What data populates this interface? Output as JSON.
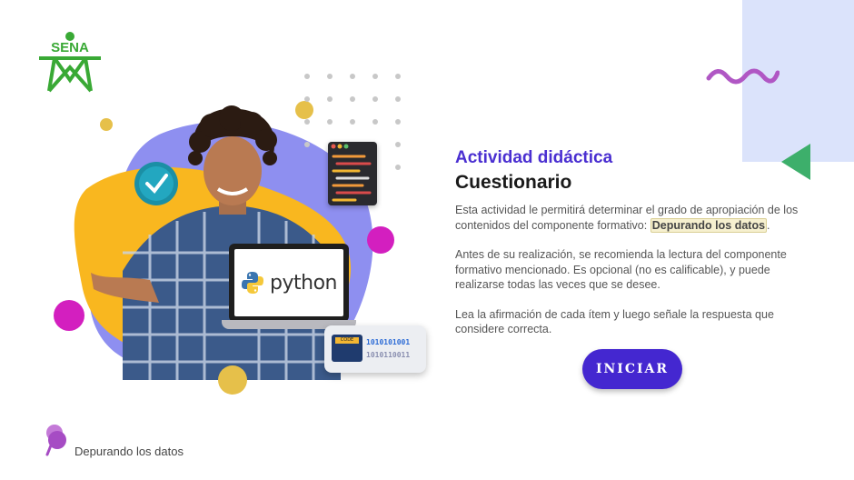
{
  "brand": {
    "logo_text": "SENA",
    "logo_color": "#39a935"
  },
  "content": {
    "activity_label": "Actividad didáctica",
    "activity_title": "Cuestionario",
    "paragraph1_text": "Esta actividad le permitirá determinar el grado de apropiación de los contenidos del componente formativo: ",
    "paragraph1_highlight": "Depurando los datos",
    "paragraph1_end": ".",
    "paragraph2": "Antes de su realización, se recomienda la lectura del componente formativo mencionado.  Es opcional (no es calificable), y puede realizarse todas las veces que se desee.",
    "paragraph3": "Lea la afirmación de cada ítem y luego señale la respuesta que considere correcta."
  },
  "actions": {
    "start_label": "INICIAR"
  },
  "illustration": {
    "laptop_text": "python",
    "code_card_label": "CODE",
    "binary_line1": "1010101001",
    "binary_line2": "1010110011"
  },
  "footer": {
    "component_name": "Depurando los datos",
    "icon": "push-pin-icon"
  },
  "colors": {
    "accent": "#4427d0",
    "heading_purple": "#4a2fd1",
    "blue_panel": "#dbe3fb",
    "triangle_green": "#3daf6b",
    "wave_purple": "#b057c4",
    "blob_yellow": "#f9b71f",
    "blob_lavender": "#8e8ff0"
  }
}
